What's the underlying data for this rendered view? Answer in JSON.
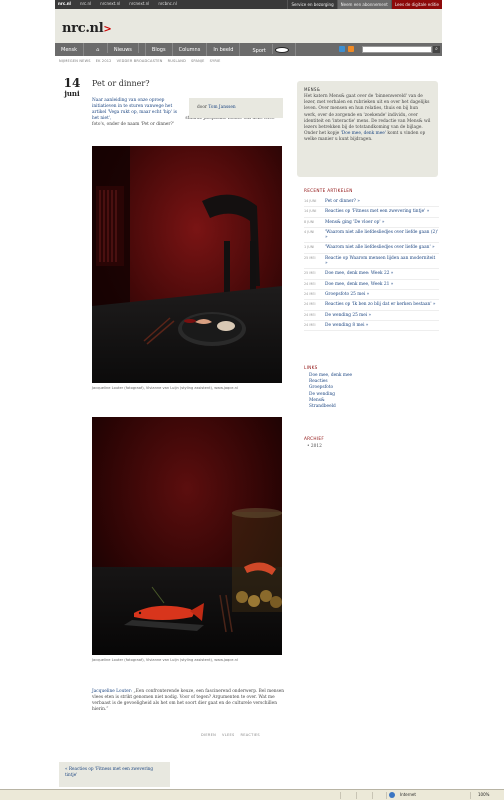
{
  "topbar": {
    "sites": [
      "nrc.nl",
      "nrc.nl",
      "nrcnext.nl",
      "nrcnext.nl",
      "nrcbnc.nl"
    ],
    "actions": [
      "Service en bezorging",
      "Neem een abonnement",
      "Lees de digitale editie"
    ]
  },
  "logo": "nrc.nl",
  "nav": {
    "items": [
      "Mensk",
      "Nieuws",
      "Blogs",
      "Columns",
      "In beeld",
      "Sport"
    ],
    "search_placeholder": ""
  },
  "breadcrumbs": [
    "NIJMEGEN NEWS",
    "EK 2012",
    "VEDDER BROADCASTEN",
    "RUSLAND",
    "SPANJE",
    "SYRIE"
  ],
  "post": {
    "day": "14",
    "month": "juni",
    "title": "Pet or dinner?",
    "intro_link": "Naar aanleiding van onze oproep initiatieven in te sturen vanwege het artikel 'Vega rukt op, maar echt 'hip' is het niet',",
    "intro_rest": "stuurde Jacqueline Louter ons deze twee foto's, onder de naam 'Pet or dinner?'",
    "author_prefix": "door",
    "author": "Tom Janssen",
    "caption1": "Jacqueline Louter (fotograaf), Vivianne van Luijn (styling assistent), www.jaqce.nl",
    "caption2": "Jacqueline Louter (fotograaf), Vivianne van Luijn (styling assistent), www.jaqce.nl",
    "quote_author": "Jacqueline Louter:",
    "quote_text": "„Een confronterende keuze, een fascinerend onderwerp. Bel mensen vlees eten is strikt genomen niet nodig. Voor of tegen? Argumenten te over. Wat me verbaast is de gevoeligheid als het om het soort dier gaat en de culturele verschillen hierin.”",
    "tags": [
      "DIEREN",
      "VLEES",
      "REACTIES"
    ],
    "prev_link": "« Reacties op 'Fitness met een zwevering tintje'"
  },
  "sidebar": {
    "box_title": "MENS&",
    "box_text": "Het katern Mens& gaat over de 'binnenwereld' van de lezer, met verhalen en rubrieken uit en over het dagelijks leven. Over mensen en hun relaties, thuis en bij hun werk, over de zorgende en 'zoekende' individu, over identiteit en 'interactie' mens. De redactie van Mens& wil lezers betrekken bij de totstandkoming van de bijlage. Onder het kopje",
    "box_link": "'Doe mee, denk mee'",
    "box_text2": "komt u vinden op welke manier u kunt bijdragen.",
    "recent_title": "RECENTE ARTIKELEN",
    "recent": [
      {
        "date": "14 JUNI",
        "title": "Pet or dinner? »"
      },
      {
        "date": "14 JUNI",
        "title": "Reacties op 'Fitness met een zwevering tintje' »"
      },
      {
        "date": "8 JUNI",
        "title": "Mens& ging 'De vloer op' »"
      },
      {
        "date": "4 JUNI",
        "title": "'Waarom niet alle liefdesliedjes over liefde gaan (2)' »"
      },
      {
        "date": "1 JUNI",
        "title": "'Waarom niet alle liefdesliedjes over liefde gaan' »"
      },
      {
        "date": "25 MEI",
        "title": "Reactie op Waarom mensen lijden aan moderniteit »"
      },
      {
        "date": "25 MEI",
        "title": "Doe mee, denk mee: Week 22 »"
      },
      {
        "date": "24 MEI",
        "title": "Doe mee, denk mee, Week 21 »"
      },
      {
        "date": "24 MEI",
        "title": "Groepsfoto 25 mei »"
      },
      {
        "date": "24 MEI",
        "title": "Reacties op 'Ik ben zo blij dat er kerken bestaan' »"
      },
      {
        "date": "24 MEI",
        "title": "De wending 25 mei »"
      },
      {
        "date": "24 MEI",
        "title": "De wending 8 mei »"
      }
    ],
    "links_title": "LINKS",
    "links": [
      "Doe mee, denk mee",
      "Reacties",
      "Groepsfoto",
      "De wending",
      "Mens&",
      "Strandbeeld"
    ],
    "archive_title": "ARCHIEF",
    "archive": [
      "2012"
    ]
  },
  "statusbar": {
    "zone": "Internet",
    "zoom": "100%"
  },
  "colors": {
    "accent": "#8d0a0a",
    "link": "#1a4480",
    "panel": "#e8e8e0",
    "nav": "#6b6b6b"
  }
}
